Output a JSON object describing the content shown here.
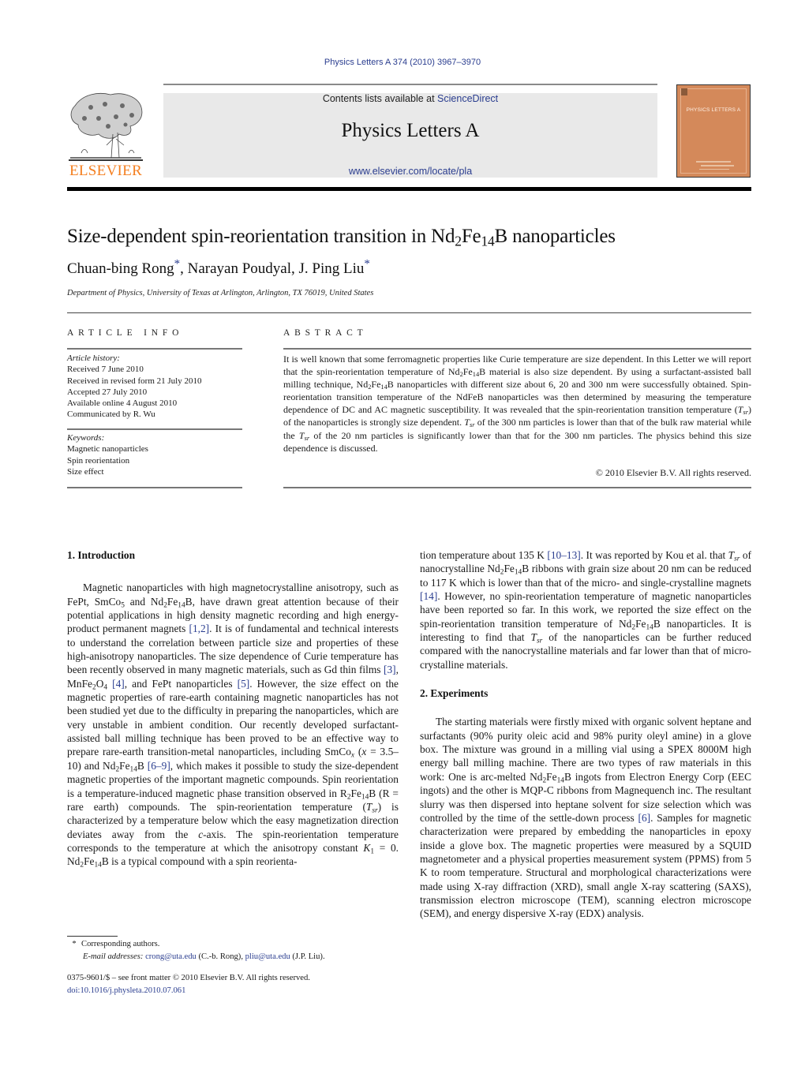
{
  "header": {
    "journal_ref": "Physics Letters A 374 (2010) 3967–3970",
    "contents_prefix": "Contents lists available at ",
    "contents_link": "ScienceDirect",
    "journal_title": "Physics Letters A",
    "journal_url": "www.elsevier.com/locate/pla",
    "publisher_logo_text": "ELSEVIER",
    "cover_title": "PHYSICS LETTERS A",
    "brand_orange": "#f47f20",
    "link_blue": "#2a3d8f",
    "cover_color": "#d4895a"
  },
  "article": {
    "title_pre": "Size-dependent spin-reorientation transition in Nd",
    "title_sub1": "2",
    "title_mid": "Fe",
    "title_sub2": "14",
    "title_post": "B nanoparticles",
    "authors": [
      {
        "name": "Chuan-bing Rong",
        "mark": "*",
        "sep": ", "
      },
      {
        "name": "Narayan Poudyal",
        "mark": "",
        "sep": ", "
      },
      {
        "name": "J. Ping Liu",
        "mark": "*",
        "sep": ""
      }
    ],
    "affiliation": "Department of Physics, University of Texas at Arlington, Arlington, TX 76019, United States"
  },
  "article_info": {
    "label": "ARTICLE INFO",
    "history_label": "Article history:",
    "history": [
      "Received 7 June 2010",
      "Received in revised form 21 July 2010",
      "Accepted 27 July 2010",
      "Available online 4 August 2010",
      "Communicated by R. Wu"
    ],
    "keywords_label": "Keywords:",
    "keywords": [
      "Magnetic nanoparticles",
      "Spin reorientation",
      "Size effect"
    ]
  },
  "abstract": {
    "label": "ABSTRACT",
    "s1": "It is well known that some ferromagnetic properties like Curie temperature are size dependent. In this Letter we will report that the spin-reorientation temperature of Nd",
    "s2": "Fe",
    "s3": "B material is also size dependent. By using a surfactant-assisted ball milling technique, Nd",
    "s4": "Fe",
    "s5": "B nanoparticles with different size about 6, 20 and 300 nm were successfully obtained. Spin-reorientation transition temperature of the NdFeB nanoparticles was then determined by measuring the temperature dependence of DC and AC magnetic susceptibility. It was revealed that the spin-reorientation transition temperature (",
    "s6": ") of the nanoparticles is strongly size dependent. ",
    "s7": " of the 300 nm particles is lower than that of the bulk raw material while the ",
    "s8": " of the 20 nm particles is significantly lower than that for the 300 nm particles. The physics behind this size dependence is discussed.",
    "copyright": "© 2010 Elsevier B.V. All rights reserved."
  },
  "symbols": {
    "T": "T",
    "sr": "sr",
    "sub2": "2",
    "sub14": "14",
    "sub4": "4",
    "sub5": "5",
    "subx": "x",
    "sub1": "1"
  },
  "sections": {
    "intro_heading": "1.  Introduction",
    "intro": {
      "a1": "Magnetic nanoparticles with high magnetocrystalline anisotropy, such as FePt, SmCo",
      "a2": " and Nd",
      "a3": "Fe",
      "a4": "B, have drawn great attention because of their potential applications in high density magnetic recording and high energy-product permanent magnets ",
      "ref12": "[1,2]",
      "a5": ". It is of fundamental and technical interests to understand the correlation between particle size and properties of these high-anisotropy nanoparticles. The size dependence of Curie temperature has been recently observed in many magnetic materials, such as Gd thin films ",
      "ref3": "[3]",
      "a6": ", MnFe",
      "a7": "O",
      "ref4": "[4]",
      "a8": ", and FePt nanoparticles ",
      "ref5": "[5]",
      "a9": ". However, the size effect on the magnetic properties of rare-earth containing magnetic nanoparticles has not been studied yet due to the difficulty in preparing the nanoparticles, which are very unstable in ambient condition. Our recently developed surfactant-assisted ball milling technique has been proved to be an effective way to prepare rare-earth transition-metal nanoparticles, including SmCo",
      "a10": "(",
      "a11": " = 3.5–10) and Nd",
      "a12": "Fe",
      "a13": "B ",
      "ref69": "[6–9]",
      "a14": ", which makes it possible to study the size-dependent magnetic properties of the important magnetic compounds. Spin reorientation is a temperature-induced magnetic phase transition observed in R",
      "a15": "Fe",
      "a16": "B (R = rare earth) compounds. The spin-reorientation temperature (",
      "a17": ") is characterized by a temperature below which the easy magnetization direction deviates away from the ",
      "c": "c",
      "a18": "-axis. The spin-reorientation temperature corresponds to the temperature at which the anisotropy constant ",
      "K": "K",
      "a19": " = 0. Nd",
      "a20": "Fe",
      "a21": "B is a typical compound with a spin reorienta-",
      "b1": "tion temperature about 135 K ",
      "ref1013": "[10–13]",
      "b2": ". It was reported by Kou et al. that ",
      "b3": " of nanocrystalline Nd",
      "b4": "Fe",
      "b5": "B ribbons with grain size about 20 nm can be reduced to 117 K which is lower than that of the micro- and single-crystalline magnets ",
      "ref14": "[14]",
      "b6": ". However, no spin-reorientation temperature of magnetic nanoparticles have been reported so far. In this work, we reported the size effect on the spin-reorientation transition temperature of Nd",
      "b7": "Fe",
      "b8": "B nanoparticles. It is interesting to find that ",
      "b9": " of the nanoparticles can be further reduced compared with the nanocrystalline materials and far lower than that of micro-crystalline materials."
    },
    "exp_heading": "2.  Experiments",
    "exp": {
      "e1": "The starting materials were firstly mixed with organic solvent heptane and surfactants (90% purity oleic acid and 98% purity oleyl amine) in a glove box. The mixture was ground in a milling vial using a SPEX 8000M high energy ball milling machine. There are two types of raw materials in this work: One is arc-melted Nd",
      "e2": "Fe",
      "e3": "B ingots from Electron Energy Corp (EEC ingots) and the other is MQP-C ribbons from Magnequench inc. The resultant slurry was then dispersed into heptane solvent for size selection which was controlled by the time of the settle-down process ",
      "ref6": "[6]",
      "e4": ". Samples for magnetic characterization were prepared by embedding the nanoparticles in epoxy inside a glove box. The magnetic properties were measured by a SQUID magnetometer and a physical properties measurement system (PPMS) from 5 K to room temperature. Structural and morphological characterizations were made using X-ray diffraction (XRD), small angle X-ray scattering (SAXS), transmission electron microscope (TEM), scanning electron microscope (SEM), and energy dispersive X-ray (EDX) analysis."
    }
  },
  "footnotes": {
    "star": "*",
    "corresponding": "Corresponding authors.",
    "email_label": "E-mail addresses:",
    "email1": "crong@uta.edu",
    "email1_who": " (C.-b. Rong), ",
    "email2": "pliu@uta.edu",
    "email2_who": " (J.P. Liu).",
    "front_matter": "0375-9601/$ – see front matter  © 2010 Elsevier B.V. All rights reserved.",
    "doi": "doi:10.1016/j.physleta.2010.07.061"
  }
}
